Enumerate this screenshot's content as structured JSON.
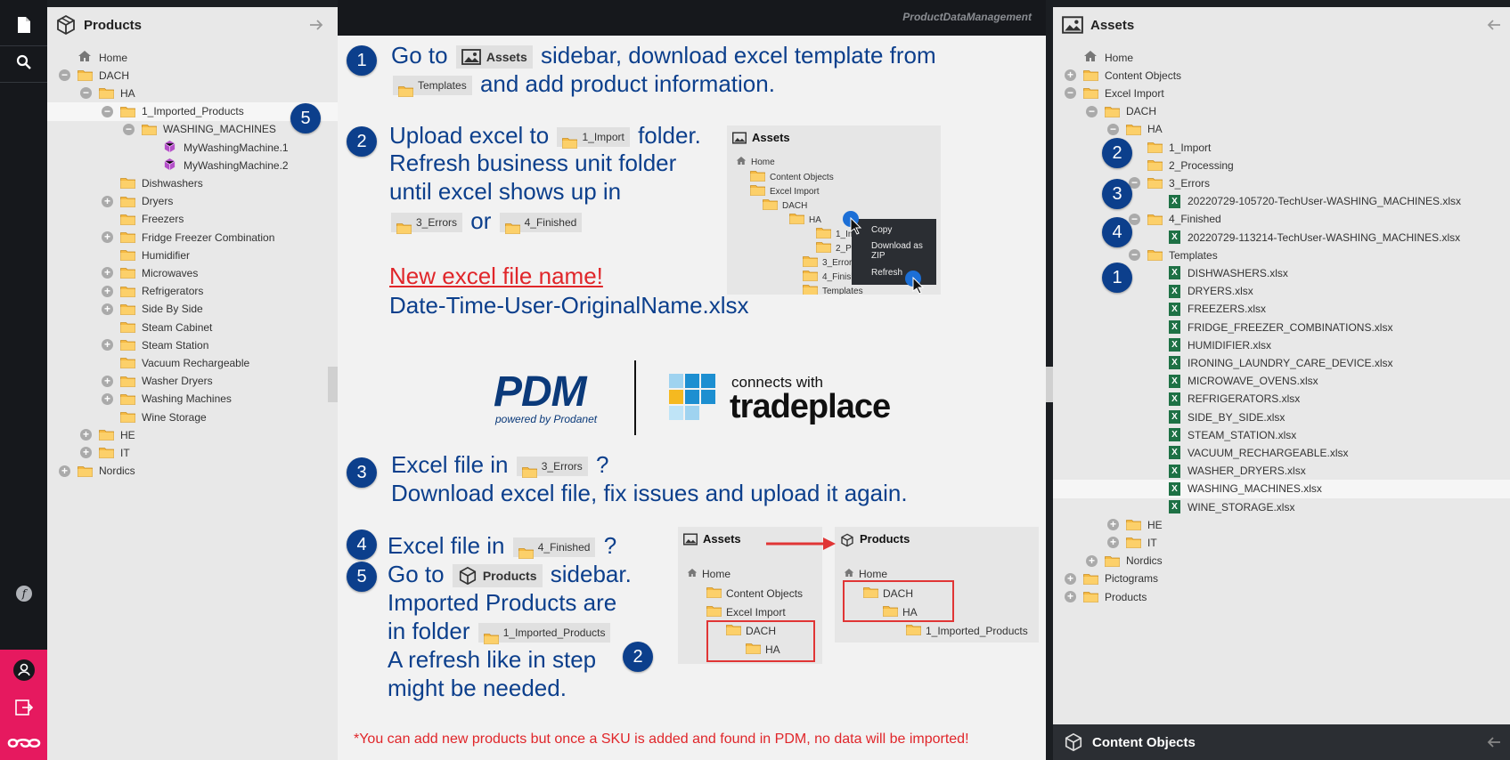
{
  "left_panel": {
    "title": "Products",
    "tree": [
      {
        "label": "Home",
        "type": "home"
      },
      {
        "label": "DACH",
        "type": "folder",
        "toggle": "minus"
      },
      {
        "label": "HA",
        "type": "folder",
        "toggle": "minus"
      },
      {
        "label": "1_Imported_Products",
        "type": "folder",
        "toggle": "minus",
        "selected": true
      },
      {
        "label": "WASHING_MACHINES",
        "type": "folder",
        "toggle": "minus"
      },
      {
        "label": "MyWashingMachine.1",
        "type": "object"
      },
      {
        "label": "MyWashingMachine.2",
        "type": "object"
      },
      {
        "label": "Dishwashers",
        "type": "folder"
      },
      {
        "label": "Dryers",
        "type": "folder",
        "toggle": "plus"
      },
      {
        "label": "Freezers",
        "type": "folder"
      },
      {
        "label": "Fridge Freezer Combination",
        "type": "folder",
        "toggle": "plus"
      },
      {
        "label": "Humidifier",
        "type": "folder"
      },
      {
        "label": "Microwaves",
        "type": "folder",
        "toggle": "plus"
      },
      {
        "label": "Refrigerators",
        "type": "folder",
        "toggle": "plus"
      },
      {
        "label": "Side By Side",
        "type": "folder",
        "toggle": "plus"
      },
      {
        "label": "Steam Cabinet",
        "type": "folder"
      },
      {
        "label": "Steam Station",
        "type": "folder",
        "toggle": "plus"
      },
      {
        "label": "Vacuum Rechargeable",
        "type": "folder"
      },
      {
        "label": "Washer Dryers",
        "type": "folder",
        "toggle": "plus"
      },
      {
        "label": "Washing Machines",
        "type": "folder",
        "toggle": "plus"
      },
      {
        "label": "Wine Storage",
        "type": "folder"
      },
      {
        "label": "HE",
        "type": "folder",
        "toggle": "plus"
      },
      {
        "label": "IT",
        "type": "folder",
        "toggle": "plus"
      },
      {
        "label": "Nordics",
        "type": "folder",
        "toggle": "plus"
      }
    ]
  },
  "right_panel": {
    "title": "Assets",
    "bottom_title": "Content Objects",
    "tree": [
      {
        "label": "Home",
        "type": "home"
      },
      {
        "label": "Content Objects",
        "type": "folder",
        "toggle": "plus"
      },
      {
        "label": "Excel Import",
        "type": "folder",
        "toggle": "minus"
      },
      {
        "label": "DACH",
        "type": "folder",
        "toggle": "minus"
      },
      {
        "label": "HA",
        "type": "folder",
        "toggle": "minus"
      },
      {
        "label": "1_Import",
        "type": "folder"
      },
      {
        "label": "2_Processing",
        "type": "folder"
      },
      {
        "label": "3_Errors",
        "type": "folder",
        "toggle": "minus"
      },
      {
        "label": "20220729-105720-TechUser-WASHING_MACHINES.xlsx",
        "type": "xls"
      },
      {
        "label": "4_Finished",
        "type": "folder",
        "toggle": "minus"
      },
      {
        "label": "20220729-113214-TechUser-WASHING_MACHINES.xlsx",
        "type": "xls"
      },
      {
        "label": "Templates",
        "type": "folder",
        "toggle": "minus"
      },
      {
        "label": "DISHWASHERS.xlsx",
        "type": "xls"
      },
      {
        "label": "DRYERS.xlsx",
        "type": "xls"
      },
      {
        "label": "FREEZERS.xlsx",
        "type": "xls"
      },
      {
        "label": "FRIDGE_FREEZER_COMBINATIONS.xlsx",
        "type": "xls"
      },
      {
        "label": "HUMIDIFIER.xlsx",
        "type": "xls"
      },
      {
        "label": "IRONING_LAUNDRY_CARE_DEVICE.xlsx",
        "type": "xls"
      },
      {
        "label": "MICROWAVE_OVENS.xlsx",
        "type": "xls"
      },
      {
        "label": "REFRIGERATORS.xlsx",
        "type": "xls"
      },
      {
        "label": "SIDE_BY_SIDE.xlsx",
        "type": "xls"
      },
      {
        "label": "STEAM_STATION.xlsx",
        "type": "xls"
      },
      {
        "label": "VACUUM_RECHARGEABLE.xlsx",
        "type": "xls"
      },
      {
        "label": "WASHER_DRYERS.xlsx",
        "type": "xls"
      },
      {
        "label": "WASHING_MACHINES.xlsx",
        "type": "xls",
        "selected": true
      },
      {
        "label": "WINE_STORAGE.xlsx",
        "type": "xls"
      },
      {
        "label": "HE",
        "type": "folder",
        "toggle": "plus"
      },
      {
        "label": "IT",
        "type": "folder",
        "toggle": "plus"
      },
      {
        "label": "Nordics",
        "type": "folder",
        "toggle": "plus"
      },
      {
        "label": "Pictograms",
        "type": "folder",
        "toggle": "plus"
      },
      {
        "label": "Products",
        "type": "folder",
        "toggle": "plus"
      }
    ],
    "markers": [
      "2",
      "3",
      "4",
      "1"
    ]
  },
  "topbar": {
    "brand_text": "ProductDataManagement"
  },
  "steps": {
    "s1": {
      "num": "1",
      "a": "Go to",
      "chip_assets": "Assets",
      "b": "sidebar, download excel template from",
      "chip_templates": "Templates",
      "c": "and add product information."
    },
    "s2": {
      "num": "2",
      "a": "Upload excel to",
      "chip_import": "1_Import",
      "b": "folder.",
      "l2": "Refresh business unit folder",
      "l3": "until excel shows up in",
      "chip_errors": "3_Errors",
      "or": "or",
      "chip_finished": "4_Finished",
      "red": "New excel file name!",
      "fmt": "Date-Time-User-OriginalName.xlsx"
    },
    "s3": {
      "num": "3",
      "a": "Excel file in",
      "chip": "3_Errors",
      "q": "?",
      "b": "Download excel file, fix issues and upload it again."
    },
    "s4": {
      "num": "4",
      "a": "Excel file in",
      "chip": "4_Finished",
      "q": "?"
    },
    "s5": {
      "num": "5",
      "a": "Go to",
      "chip": "Products",
      "b": "sidebar.",
      "l2": "Imported Products are",
      "l3a": "in folder",
      "chip2": "1_Imported_Products",
      "l4": "A refresh like in step",
      "l4num": "2",
      "l5": "might be needed."
    }
  },
  "logos": {
    "pdm": "PDM",
    "pdm_sub": "powered by Prodanet",
    "connects": "connects with",
    "tradeplace": "tradeplace"
  },
  "mini_assets": {
    "title": "Assets",
    "rows": [
      "Home",
      "Content Objects",
      "Excel Import",
      "DACH",
      "HA",
      "1_Import",
      "2_Process",
      "3_Errors",
      "4_Finished",
      "Templates"
    ]
  },
  "context_menu": [
    "Copy",
    "Download as ZIP",
    "Refresh"
  ],
  "mini_assets2": {
    "title": "Assets",
    "rows": [
      "Home",
      "Content Objects",
      "Excel Import",
      "DACH",
      "HA"
    ]
  },
  "mini_products": {
    "title": "Products",
    "rows": [
      "Home",
      "DACH",
      "HA",
      "1_Imported_Products"
    ]
  },
  "footer_note": "*You can add new products but once a SKU is added and found in PDM, no data will be imported!",
  "left_marker": "5",
  "colors": {
    "accent": "#e6195f",
    "bubble": "#0c3f8c",
    "note_red": "#e0262a",
    "folder": "#f5b942"
  }
}
